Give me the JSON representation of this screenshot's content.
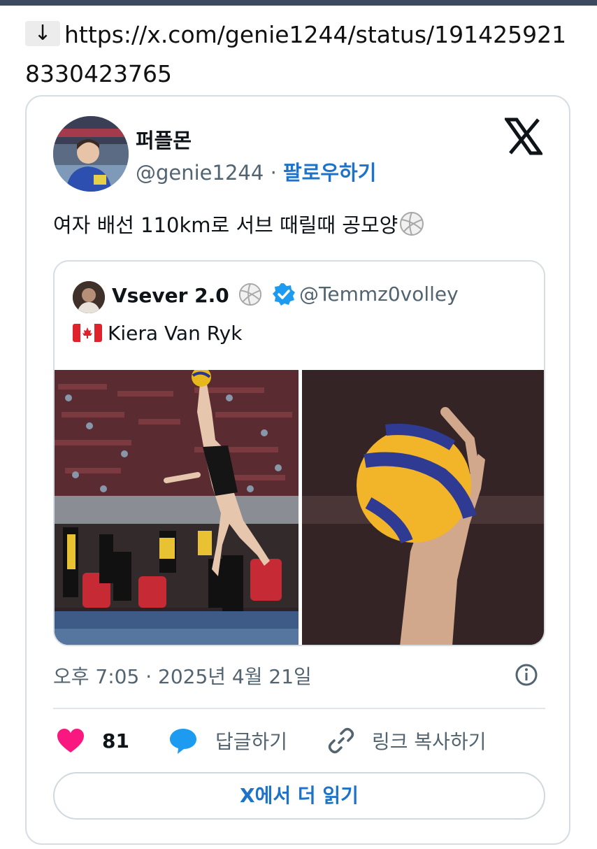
{
  "link": {
    "arrow": "↓",
    "url": "https://x.com/genie1244/status/1914259218330423765"
  },
  "tweet": {
    "display_name": "퍼플몬",
    "handle": "@genie1244",
    "separator": "·",
    "follow_label": "팔로우하기",
    "text": "여자 배선 110km로 서브 때릴때 공모양",
    "emoji_icon": "volleyball-icon",
    "timestamp": "오후 7:05 · 2025년 4월 21일"
  },
  "quote": {
    "display_name": "Vsever 2.0",
    "handle": "@Temmz0volley",
    "verified": true,
    "flag_icon": "canada-flag-icon",
    "text": "Kiera Van Ryk"
  },
  "actions": {
    "like_count": "81",
    "reply_label": "답글하기",
    "copy_link_label": "링크 복사하기"
  },
  "read_more_label": "X에서 더 읽기",
  "colors": {
    "accent": "#1d72c9",
    "heart": "#f91880",
    "reply_bubble": "#1d9bf0",
    "muted": "#536471",
    "border": "#d6dde3"
  }
}
